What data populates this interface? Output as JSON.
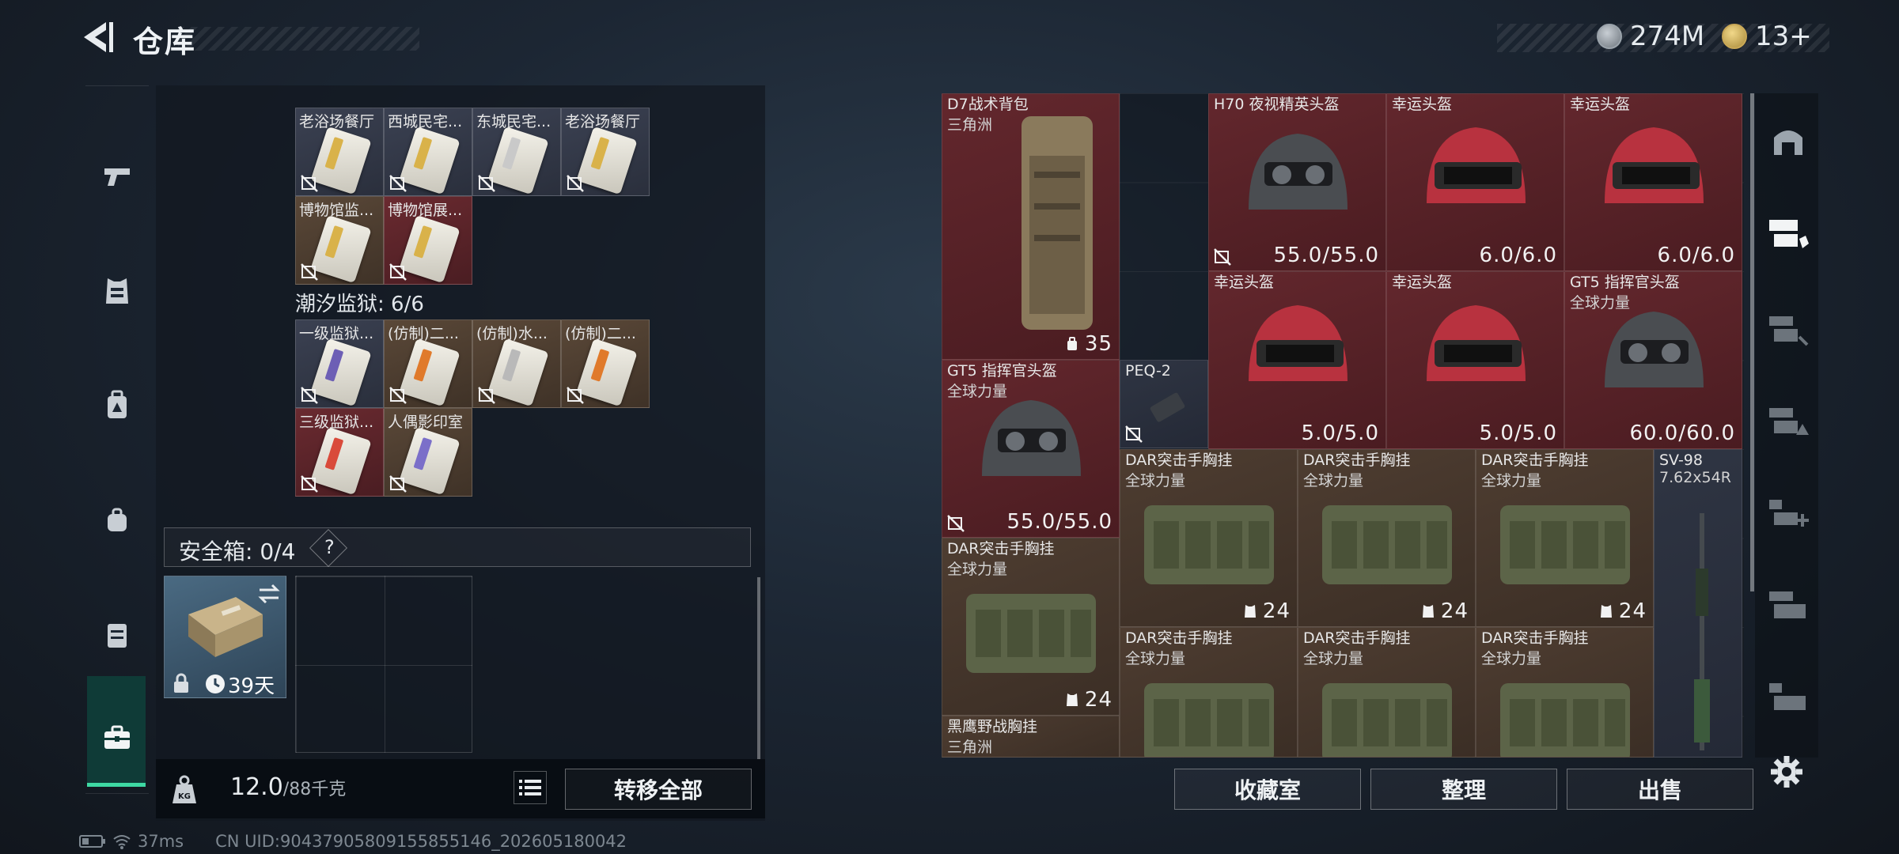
{
  "header": {
    "title": "仓库",
    "currency_1": "274M",
    "currency_2": "13+"
  },
  "colors": {
    "accent_green": "#3ed9a3",
    "red_tier": "#63272d",
    "brown_tier": "#4e3d31",
    "slate_tier": "#2f3543"
  },
  "sidebar": {
    "items": [
      {
        "icon": "pistol-icon"
      },
      {
        "icon": "vest-icon"
      },
      {
        "icon": "backpack-icon"
      },
      {
        "icon": "pouch-icon"
      },
      {
        "icon": "chest-rig-icon"
      },
      {
        "icon": "briefcase-icon",
        "active": true
      }
    ]
  },
  "left": {
    "section_top_cards": [
      {
        "label": "老浴场餐厅",
        "tier": "slate",
        "strip": "#d9b24a"
      },
      {
        "label": "西城民宅...",
        "tier": "slate",
        "strip": "#d9b24a"
      },
      {
        "label": "东城民宅...",
        "tier": "slate",
        "strip": "#c9c9c9"
      },
      {
        "label": "老浴场餐厅",
        "tier": "slate",
        "strip": "#d9b24a"
      },
      {
        "label": "博物馆监...",
        "tier": "brown",
        "strip": "#d9b24a"
      },
      {
        "label": "博物馆展...",
        "tier": "red",
        "strip": "#d9b24a"
      }
    ],
    "prison_title": "潮汐监狱: 6/6",
    "prison_cards": [
      {
        "label": "一级监狱...",
        "tier": "slate",
        "strip": "#6d5fb5"
      },
      {
        "label": "(仿制)二...",
        "tier": "brown",
        "strip": "#e07a2b"
      },
      {
        "label": "(仿制)水...",
        "tier": "brown",
        "strip": "#b9b9b9"
      },
      {
        "label": "(仿制)二...",
        "tier": "brown",
        "strip": "#e07a2b"
      },
      {
        "label": "三级监狱...",
        "tier": "red",
        "strip": "#d94a3a"
      },
      {
        "label": "人偶影印室",
        "tier": "brown",
        "strip": "#7b6fc9"
      }
    ],
    "safe_box_title": "安全箱: 0/4",
    "safe_box_help": "?",
    "case_time": "39天",
    "weight_value": "12.0",
    "weight_unit": "/88千克",
    "transfer_all": "转移全部"
  },
  "stash": {
    "items": [
      {
        "name": "D7战术背包",
        "sub": "三角洲",
        "tier": "red",
        "value": "35",
        "nodeal": false
      },
      {
        "name": "H70 夜视精英头盔",
        "sub": "",
        "tier": "red",
        "value": "55.0/55.0",
        "nodeal": true
      },
      {
        "name": "幸运头盔",
        "sub": "",
        "tier": "red",
        "value": "6.0/6.0",
        "nodeal": false
      },
      {
        "name": "幸运头盔",
        "sub": "",
        "tier": "red",
        "value": "6.0/6.0",
        "nodeal": false
      },
      {
        "name": "幸运头盔",
        "sub": "",
        "tier": "red",
        "value": "5.0/5.0",
        "nodeal": false
      },
      {
        "name": "幸运头盔",
        "sub": "",
        "tier": "red",
        "value": "5.0/5.0",
        "nodeal": false
      },
      {
        "name": "GT5 指挥官头盔",
        "sub": "全球力量",
        "tier": "red",
        "value": "60.0/60.0",
        "nodeal": false
      },
      {
        "name": "GT5 指挥官头盔",
        "sub": "全球力量",
        "tier": "red",
        "value": "55.0/55.0",
        "nodeal": true
      },
      {
        "name": "PEQ-2",
        "sub": "",
        "tier": "slate",
        "value": "",
        "nodeal": true
      },
      {
        "name": "DAR突击手胸挂",
        "sub": "全球力量",
        "tier": "brown",
        "value": "24",
        "nodeal": false
      },
      {
        "name": "DAR突击手胸挂",
        "sub": "全球力量",
        "tier": "brown",
        "value": "24",
        "nodeal": false
      },
      {
        "name": "DAR突击手胸挂",
        "sub": "全球力量",
        "tier": "brown",
        "value": "24",
        "nodeal": false
      },
      {
        "name": "SV-98",
        "sub": "7.62x54R",
        "tier": "slate",
        "value": "",
        "nodeal": false
      },
      {
        "name": "DAR突击手胸挂",
        "sub": "全球力量",
        "tier": "brown",
        "value": "24",
        "nodeal": false
      },
      {
        "name": "DAR突击手胸挂",
        "sub": "全球力量",
        "tier": "brown",
        "value": "",
        "nodeal": false
      },
      {
        "name": "DAR突击手胸挂",
        "sub": "全球力量",
        "tier": "brown",
        "value": "",
        "nodeal": false
      },
      {
        "name": "DAR突击手胸挂",
        "sub": "全球力量",
        "tier": "brown",
        "value": "",
        "nodeal": false
      },
      {
        "name": "黑鹰野战胸挂",
        "sub": "三角洲",
        "tier": "brown",
        "value": "",
        "nodeal": false
      }
    ],
    "buttons": {
      "collection": "收藏室",
      "organize": "整理",
      "sell": "出售"
    }
  },
  "status_bar": {
    "ping": "37ms",
    "uid": "CN UID:90437905809155855146_202605180042"
  }
}
